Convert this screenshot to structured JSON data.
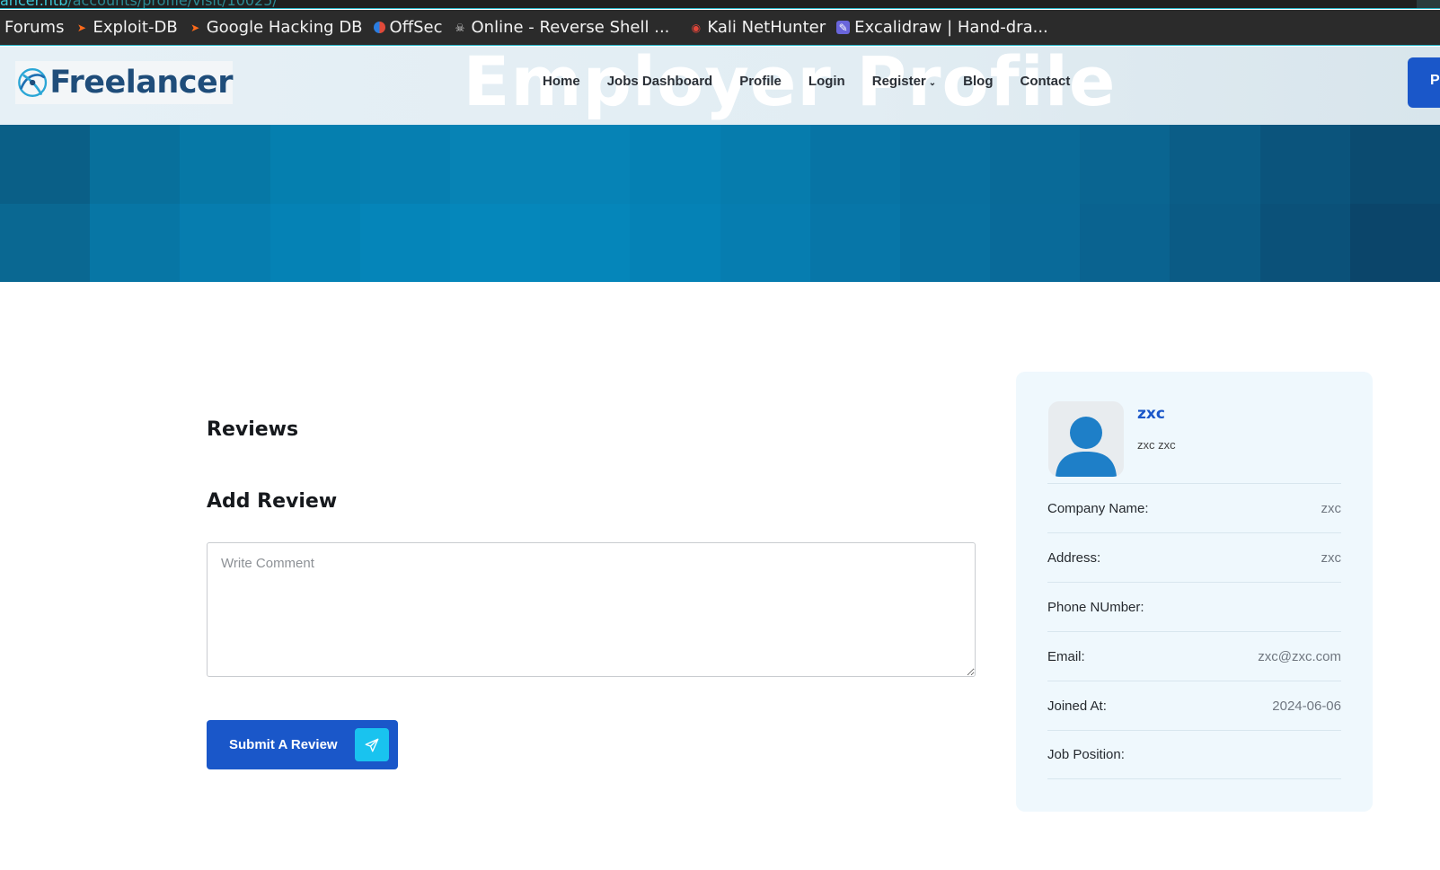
{
  "browser": {
    "url_host": "ancer.htb",
    "url_path": "/accounts/profile/visit/10025/",
    "bookmarks": [
      {
        "label": "Forums",
        "icon": "none"
      },
      {
        "label": "Exploit-DB",
        "icon": "exploit-db-icon"
      },
      {
        "label": "Google Hacking DB",
        "icon": "exploit-db-icon"
      },
      {
        "label": "OffSec",
        "icon": "offsec-icon"
      },
      {
        "label": "Online - Reverse Shell ...",
        "icon": "skull-icon"
      },
      {
        "label": "Kali NetHunter",
        "icon": "kali-icon"
      },
      {
        "label": "Excalidraw | Hand-dra...",
        "icon": "excalidraw-icon"
      }
    ]
  },
  "header": {
    "brand": "Freelancer",
    "page_title": "Employer Profile",
    "nav": {
      "home": "Home",
      "jobs": "Jobs Dashboard",
      "profile": "Profile",
      "login": "Login",
      "register": "Register",
      "blog": "Blog",
      "contact": "Contact"
    },
    "cta_partial": "P"
  },
  "main": {
    "reviews_heading": "Reviews",
    "add_review_heading": "Add Review",
    "comment_placeholder": "Write Comment",
    "submit_label": "Submit A Review"
  },
  "profile": {
    "username": "zxc",
    "full_name": "zxc zxc",
    "fields": [
      {
        "label": "Company Name:",
        "value": "zxc"
      },
      {
        "label": "Address:",
        "value": "zxc"
      },
      {
        "label": "Phone NUmber:",
        "value": ""
      },
      {
        "label": "Email:",
        "value": "zxc@zxc.com"
      },
      {
        "label": "Joined At:",
        "value": "2024-06-06"
      },
      {
        "label": "Job Position:",
        "value": ""
      }
    ]
  },
  "colors": {
    "brand_blue": "#1a57c9",
    "accent_cyan": "#19c3ef",
    "hero_blue": "#0a6f9c"
  }
}
